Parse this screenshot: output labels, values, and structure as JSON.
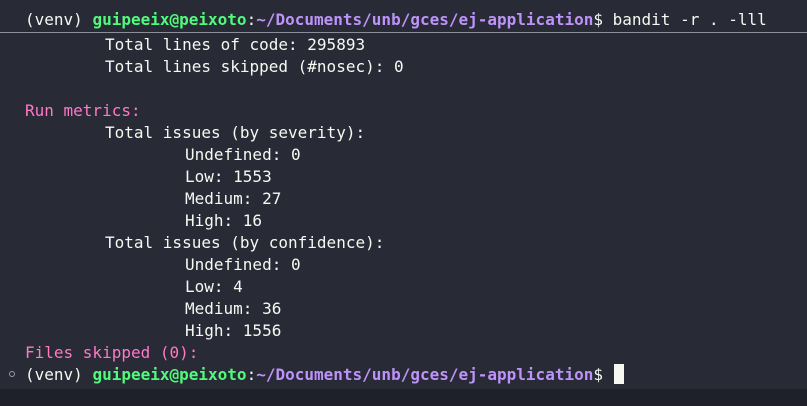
{
  "command_prompt": {
    "env": "(venv)",
    "user_host": "guipeeix@peixoto",
    "sep": ":",
    "path": "~/Documents/unb/gces/ej-application",
    "symbol": "$",
    "command": "bandit -r . -lll"
  },
  "output": {
    "total_loc": "Total lines of code: 295893",
    "total_skipped": "Total lines skipped (#nosec): 0",
    "run_metrics_header": "Run metrics:",
    "severity_header": "Total issues (by severity):",
    "severity": {
      "undefined": "Undefined: 0",
      "low": "Low: 1553",
      "medium": "Medium: 27",
      "high": "High: 16"
    },
    "confidence_header": "Total issues (by confidence):",
    "confidence": {
      "undefined": "Undefined: 0",
      "low": "Low: 4",
      "medium": "Medium: 36",
      "high": "High: 1556"
    },
    "files_skipped": "Files skipped (0):"
  },
  "active_prompt": {
    "env": "(venv)",
    "user_host": "guipeeix@peixoto",
    "sep": ":",
    "path": "~/Documents/unb/gces/ej-application",
    "symbol": "$"
  },
  "colors": {
    "background": "#282a36",
    "foreground": "#f8f8f2",
    "user_host": "#50fa7b",
    "path": "#bd93f9",
    "section_header": "#ff79c6"
  }
}
